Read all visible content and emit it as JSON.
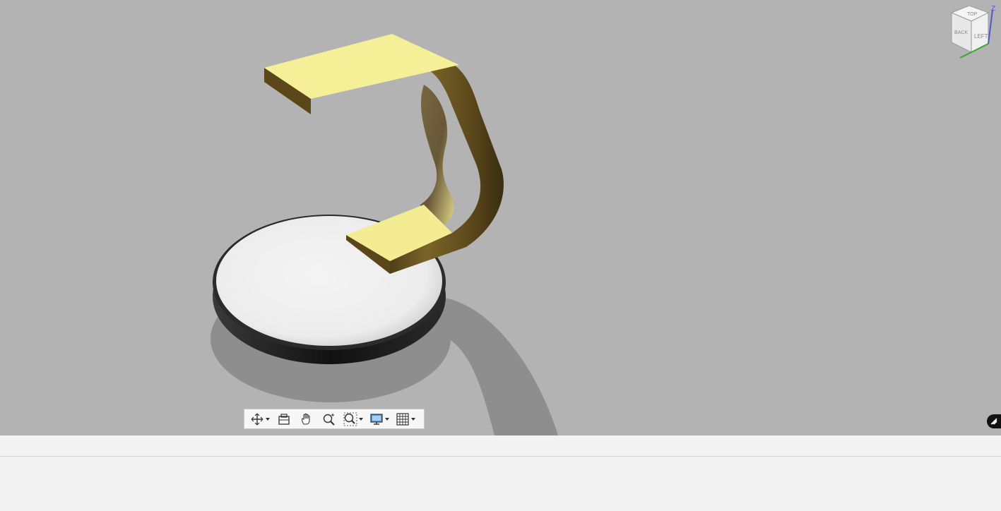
{
  "viewcube": {
    "axis_z_label": "Z",
    "face_top": "TOP",
    "face_left": "LEFT",
    "face_back": "BACK"
  },
  "nav_toolbar": {
    "items": [
      {
        "name": "orbit",
        "icon": "orbit-icon",
        "has_dropdown": true
      },
      {
        "name": "look-at",
        "icon": "look-at-icon",
        "has_dropdown": false
      },
      {
        "name": "pan",
        "icon": "hand-icon",
        "has_dropdown": false
      },
      {
        "name": "zoom",
        "icon": "zoom-icon",
        "has_dropdown": false
      },
      {
        "name": "fit",
        "icon": "zoom-window-icon",
        "has_dropdown": true
      },
      {
        "name": "display-settings",
        "icon": "monitor-icon",
        "has_dropdown": true
      },
      {
        "name": "grid-snaps",
        "icon": "grid-icon",
        "has_dropdown": true
      }
    ]
  },
  "colors": {
    "viewport_bg": "#b3b3b3",
    "brass_light": "#f5ef98",
    "brass_dark": "#6b5522",
    "base_top": "#f0f0f0",
    "base_side": "#1a1a1a"
  }
}
